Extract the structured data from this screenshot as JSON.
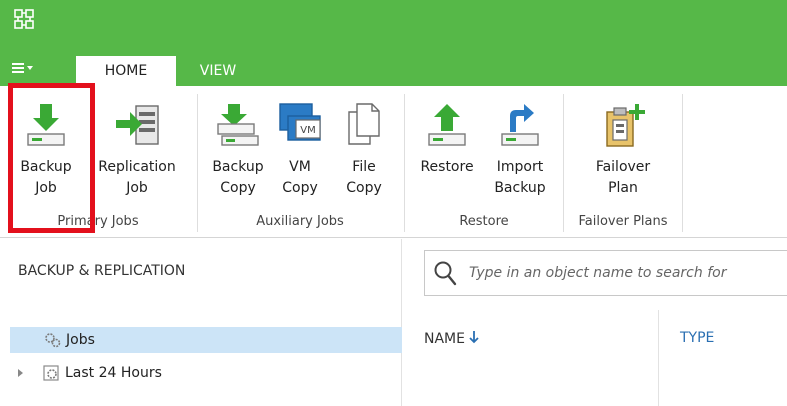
{
  "tabs": {
    "home": "HOME",
    "view": "VIEW"
  },
  "ribbon": {
    "primary_jobs": {
      "label": "Primary Jobs",
      "backup_job": [
        "Backup",
        "Job"
      ],
      "replication_job": [
        "Replication",
        "Job"
      ]
    },
    "auxiliary_jobs": {
      "label": "Auxiliary Jobs",
      "backup_copy": [
        "Backup",
        "Copy"
      ],
      "vm_copy": [
        "VM",
        "Copy"
      ],
      "file_copy": [
        "File",
        "Copy"
      ]
    },
    "restore": {
      "label": "Restore",
      "restore": [
        "Restore",
        ""
      ],
      "import_backup": [
        "Import",
        "Backup"
      ]
    },
    "failover_plans": {
      "label": "Failover Plans",
      "failover_plan": [
        "Failover",
        "Plan"
      ]
    },
    "vm_badge": "VM"
  },
  "left_panel": {
    "header": "BACKUP & REPLICATION",
    "items": [
      "Jobs",
      "Last 24 Hours"
    ]
  },
  "search": {
    "placeholder": "Type in an object name to search for"
  },
  "columns": {
    "name": "NAME",
    "type": "TYPE"
  },
  "colors": {
    "accent_green": "#56b848",
    "highlight_red": "#e3101c",
    "selection": "#cce4f7",
    "link_blue": "#2a6fb2"
  }
}
